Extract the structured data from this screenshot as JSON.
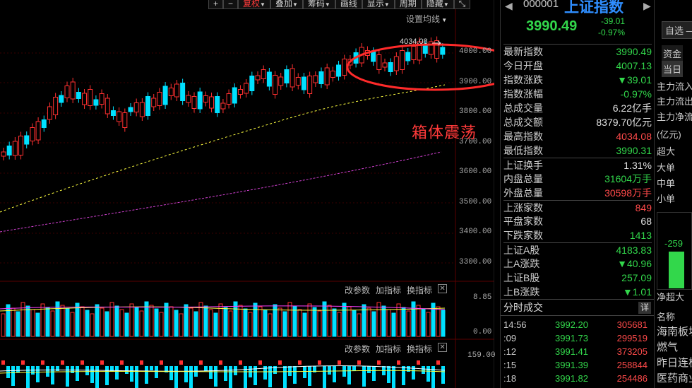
{
  "toolbar": {
    "plus": "+",
    "minus": "−",
    "adjust": "复权",
    "overlay": "叠加",
    "chips": "筹码",
    "draw": "画线",
    "display": "显示",
    "period": "周期",
    "hide": "隐藏",
    "ma_setting": "设置均线"
  },
  "chart": {
    "y_labels": [
      "4000.00",
      "3900.00",
      "3800.00",
      "3700.00",
      "3600.00",
      "3500.00",
      "3400.00",
      "3300.00"
    ],
    "high_label": "4034.08",
    "annotation": "箱体震荡"
  },
  "vol_panel": {
    "menu1": "改参数",
    "menu2": "加指标",
    "menu3": "换指标",
    "close": "✕",
    "y_top": "8.85",
    "y_bottom": "0.00"
  },
  "macd_panel": {
    "menu1": "改参数",
    "menu2": "加指标",
    "menu3": "换指标",
    "close": "✕",
    "y_top": "159.00"
  },
  "quote": {
    "code": "000001",
    "name": "上证指数",
    "price": "3990.49",
    "change": "-39.01",
    "pct": "-0.97%",
    "rows": [
      {
        "label": "最新指数",
        "value": "3990.49",
        "color": "#32d74b"
      },
      {
        "label": "今日开盘",
        "value": "4007.13",
        "color": "#32d74b"
      },
      {
        "label": "指数涨跌",
        "value": "▼39.01",
        "color": "#32d74b"
      },
      {
        "label": "指数涨幅",
        "value": "-0.97%",
        "color": "#32d74b"
      },
      {
        "label": "总成交量",
        "value": "6.22亿手",
        "color": "#e0e0e0"
      },
      {
        "label": "总成交额",
        "value": "8379.70亿元",
        "color": "#e0e0e0"
      },
      {
        "label": "最高指数",
        "value": "4034.08",
        "color": "#ff4a4a"
      },
      {
        "label": "最低指数",
        "value": "3990.31",
        "color": "#32d74b"
      },
      {
        "label": "上证换手",
        "value": "1.31%",
        "color": "#e0e0e0"
      },
      {
        "label": "内盘总量",
        "value": "31604万手",
        "color": "#32d74b"
      },
      {
        "label": "外盘总量",
        "value": "30598万手",
        "color": "#ff4a4a"
      },
      {
        "label": "上涨家数",
        "value": "849",
        "color": "#ff4a4a"
      },
      {
        "label": "平盘家数",
        "value": "68",
        "color": "#e0e0e0"
      },
      {
        "label": "下跌家数",
        "value": "1413",
        "color": "#32d74b"
      },
      {
        "label": "上证A股",
        "value": "4183.83",
        "color": "#32d74b"
      },
      {
        "label": "上A涨跌",
        "value": "▼40.96",
        "color": "#32d74b"
      },
      {
        "label": "上证B股",
        "value": "257.09",
        "color": "#32d74b"
      },
      {
        "label": "上B涨跌",
        "value": "▼1.01",
        "color": "#32d74b"
      }
    ]
  },
  "ticks": {
    "header": "分时成交",
    "detail_btn": "详",
    "rows": [
      {
        "time": "14:56",
        "price": "3992.20",
        "vol": "305681"
      },
      {
        "time": ":09",
        "price": "3991.73",
        "vol": "299519"
      },
      {
        "time": ":12",
        "price": "3991.41",
        "vol": "373205"
      },
      {
        "time": ":15",
        "price": "3991.39",
        "vol": "258844"
      },
      {
        "time": ":18",
        "price": "3991.82",
        "vol": "254486"
      }
    ]
  },
  "far_panel": {
    "zixuan": "自选",
    "fund_tab": "资金",
    "day_tab": "当日",
    "flows": [
      "主力流入",
      "主力流出",
      "主力净流"
    ],
    "unit": "(亿元)",
    "sizes": [
      "超大",
      "大单",
      "中单",
      "小单"
    ],
    "net_value": "-259",
    "net_label": "净超大",
    "list_header": "名称",
    "list": [
      "海南板块",
      "燃气",
      "昨日连板",
      "医药商业"
    ]
  }
}
